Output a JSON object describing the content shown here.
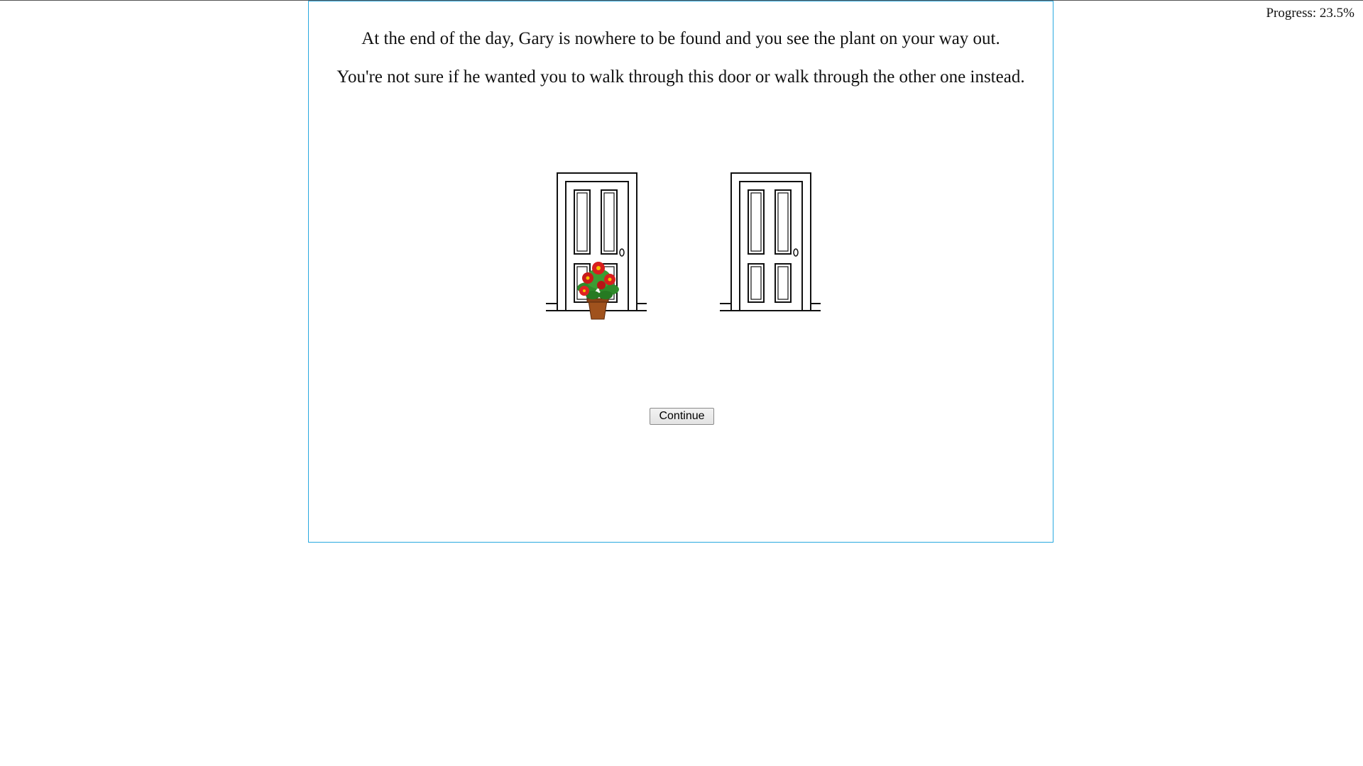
{
  "progress": {
    "label": "Progress: 23.5%",
    "value_percent": 23.5
  },
  "story": {
    "line1": "At the end of the day, Gary is nowhere to be found and you see the plant on your way out.",
    "line2": "You're not sure if he wanted you to walk through this door or walk through the other one instead."
  },
  "scene": {
    "left_door": {
      "icon": "door-icon",
      "has_plant": true,
      "plant_icon": "potted-red-flower-icon"
    },
    "right_door": {
      "icon": "door-icon",
      "has_plant": false
    }
  },
  "actions": {
    "continue_label": "Continue"
  },
  "colors": {
    "frame_border": "#29a9e0",
    "flower": "#d81e1e",
    "leaves": "#2f8a2a",
    "pot": "#a0521d"
  }
}
